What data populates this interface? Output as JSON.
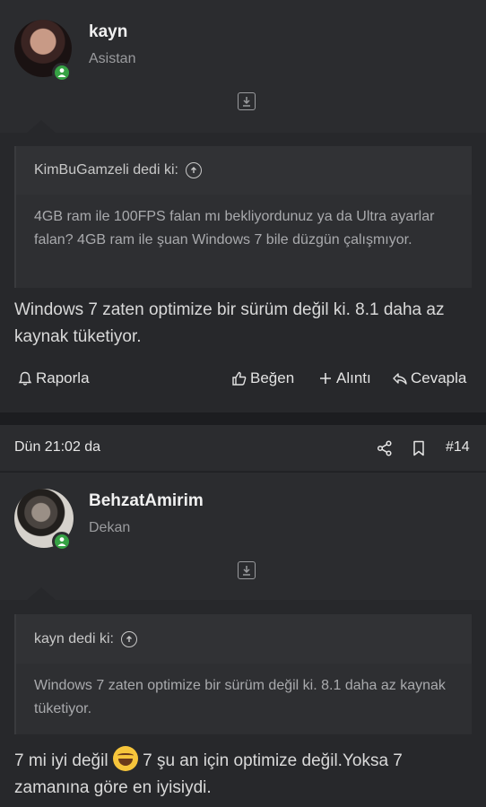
{
  "post1": {
    "username": "kayn",
    "user_title": "Asistan",
    "quote": {
      "author_line": "KimBuGamzeli dedi ki:",
      "text": "4GB ram ile 100FPS falan mı bekliyordunuz ya da Ultra ayarlar falan? 4GB ram ile şuan Windows 7 bile düzgün çalışmıyor."
    },
    "message": "Windows 7 zaten optimize bir sürüm değil ki. 8.1 daha az kaynak tüketiyor.",
    "actions": {
      "report": "Raporla",
      "like": "Beğen",
      "quote": "Alıntı",
      "reply": "Cevapla"
    }
  },
  "post2": {
    "date": "Dün 21:02 da",
    "post_number": "#14",
    "username": "BehzatAmirim",
    "user_title": "Dekan",
    "quote": {
      "author_line": "kayn dedi ki:",
      "text": "Windows 7 zaten optimize bir sürüm değil ki. 8.1 daha az kaynak tüketiyor."
    },
    "message_part1": "7 mi iyi değil",
    "message_part2": "7 şu an için optimize değil.Yoksa 7 zamanına göre en iyisiydi."
  },
  "icons": {
    "online": "user-online-icon",
    "expand": "expand-down-icon",
    "quote_jump": "arrow-up-circle-icon",
    "report": "bell-icon",
    "like": "thumbs-up-icon",
    "add_quote": "plus-icon",
    "reply": "reply-icon",
    "share": "share-icon",
    "bookmark": "bookmark-icon",
    "emoji": "laughing-tears-emoji"
  },
  "colors": {
    "background": "#1f2023",
    "online_badge": "#36a244"
  }
}
